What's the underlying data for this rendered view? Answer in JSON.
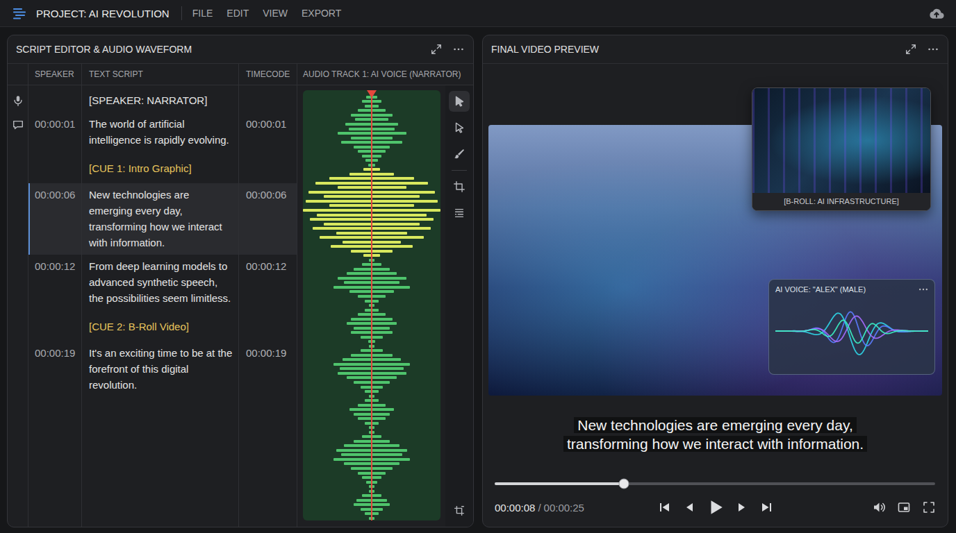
{
  "app": {
    "title": "PROJECT: AI REVOLUTION",
    "menu": [
      "FILE",
      "EDIT",
      "VIEW",
      "EXPORT"
    ]
  },
  "script_panel": {
    "title": "SCRIPT EDITOR & AUDIO WAVEFORM",
    "columns": [
      "SPEAKER",
      "TEXT SCRIPT",
      "TIMECODE",
      "AUDIO TRACK 1: AI VOICE (NARRATOR)"
    ],
    "rows": [
      {
        "kind": "speaker",
        "text": "[SPEAKER: NARRATOR]",
        "selected": false
      },
      {
        "kind": "line",
        "speaker": "00:00:01",
        "text": "The world of artificial intelligence is rapidly evolving.",
        "timecode": "00:00:01",
        "selected": false
      },
      {
        "kind": "cue",
        "text": "[CUE 1: Intro Graphic]",
        "selected": false
      },
      {
        "kind": "line",
        "speaker": "00:00:06",
        "text": "New technologies are emerging every day, transforming how we interact with information.",
        "timecode": "00:00:06",
        "selected": true
      },
      {
        "kind": "line",
        "speaker": "00:00:12",
        "text": "From deep learning models to advanced synthetic speech, the possibilities seem limitless.",
        "timecode": "00:00:12",
        "selected": false
      },
      {
        "kind": "cue",
        "text": "[CUE 2: B-Roll Video]",
        "selected": false
      },
      {
        "kind": "line",
        "speaker": "00:00:19",
        "text": "It's an exciting time to be at the forefront of this digital revolution.",
        "timecode": "00:00:19",
        "selected": false
      }
    ],
    "tools": [
      {
        "selected": true
      },
      {
        "selected": false
      },
      {
        "selected": false
      },
      {
        "selected": false
      },
      {
        "selected": false
      },
      {
        "selected": false
      }
    ]
  },
  "waveform": {
    "segments": [
      {
        "highlighted": false,
        "levels": [
          0.04,
          0.08,
          0.14,
          0.1,
          0.2,
          0.3,
          0.24,
          0.38,
          0.33,
          0.5,
          0.3,
          0.44,
          0.26,
          0.2,
          0.14,
          0.09,
          0.05
        ]
      },
      {
        "highlighted": true,
        "levels": [
          0.12,
          0.32,
          0.62,
          0.82,
          0.5,
          0.92,
          0.7,
          0.96,
          0.62,
          1.0,
          0.8,
          0.9,
          0.7,
          0.86,
          0.52,
          0.76,
          0.42,
          0.6,
          0.3,
          0.12
        ]
      },
      {
        "highlighted": false,
        "levels": [
          0.04,
          0.14,
          0.26,
          0.36,
          0.5,
          0.4,
          0.56,
          0.32,
          0.2,
          0.1,
          0.04
        ]
      },
      {
        "highlighted": false,
        "levels": [
          0.1,
          0.2,
          0.3,
          0.36,
          0.26,
          0.3,
          0.16,
          0.05
        ]
      },
      {
        "highlighted": false,
        "levels": [
          0.04,
          0.16,
          0.3,
          0.42,
          0.56,
          0.46,
          0.5,
          0.36,
          0.26,
          0.16,
          0.1,
          0.04
        ]
      },
      {
        "highlighted": false,
        "levels": [
          0.1,
          0.2,
          0.32,
          0.26,
          0.2,
          0.1,
          0.04
        ]
      },
      {
        "highlighted": false,
        "levels": [
          0.04,
          0.14,
          0.26,
          0.4,
          0.52,
          0.44,
          0.56,
          0.4,
          0.3,
          0.2,
          0.14,
          0.08,
          0.04
        ]
      },
      {
        "highlighted": false,
        "levels": [
          0.04,
          0.14,
          0.22,
          0.26,
          0.16,
          0.1,
          0.04
        ]
      }
    ]
  },
  "preview_panel": {
    "title": "FINAL VIDEO PREVIEW",
    "broll_caption": "[B-ROLL: AI INFRASTRUCTURE]",
    "voice_card": {
      "title": "AI VOICE: \"ALEX\" (MALE)"
    },
    "subtitle_lines": [
      "New technologies are emerging every day,",
      "transforming how we interact with information."
    ],
    "progress": {
      "level": 0.294
    },
    "time": {
      "current": "00:00:08",
      "separator": "/",
      "total": "00:00:25"
    },
    "playing": false
  }
}
